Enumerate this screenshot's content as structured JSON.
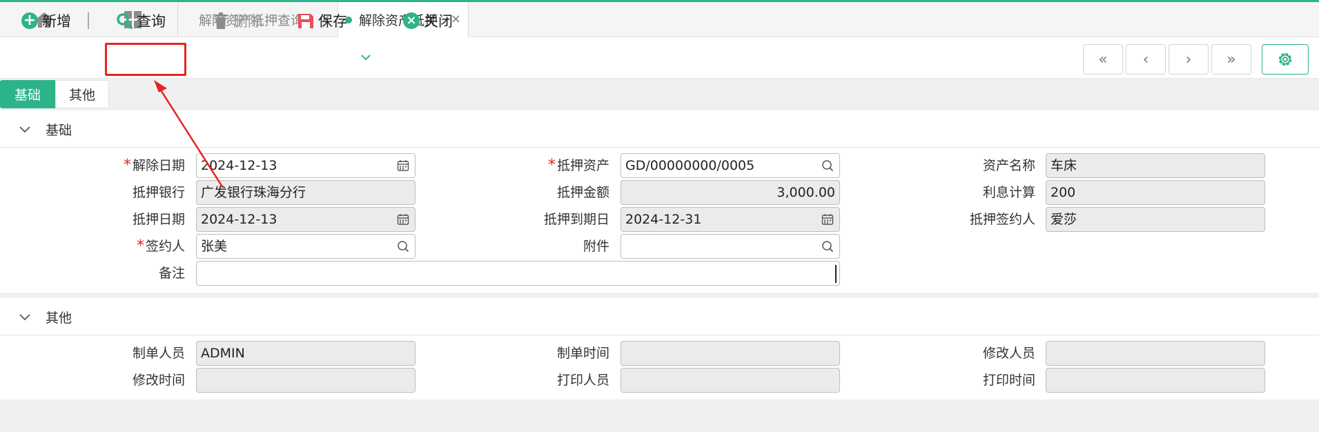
{
  "tabs": [
    {
      "label": "解除资产抵押查询",
      "close": "×"
    },
    {
      "label": "解除资产抵押",
      "close": "×"
    }
  ],
  "toolbar": {
    "add": "新增",
    "query": "查询",
    "delete": "删除",
    "save": "保存",
    "close": "关闭"
  },
  "nav": {
    "first": "«",
    "prev": "‹",
    "next": "›",
    "last": "»"
  },
  "subtabs": [
    "基础",
    "其他"
  ],
  "basic": {
    "title": "基础",
    "fields": {
      "release_date": {
        "label": "解除日期",
        "value": "2024-12-13"
      },
      "pledged_asset": {
        "label": "抵押资产",
        "value": "GD/00000000/0005"
      },
      "asset_name": {
        "label": "资产名称",
        "value": "车床"
      },
      "pledge_bank": {
        "label": "抵押银行",
        "value": "广发银行珠海分行"
      },
      "pledge_amount": {
        "label": "抵押金额",
        "value": "3,000.00"
      },
      "interest_calc": {
        "label": "利息计算",
        "value": "200"
      },
      "pledge_date": {
        "label": "抵押日期",
        "value": "2024-12-13"
      },
      "pledge_due_date": {
        "label": "抵押到期日",
        "value": "2024-12-31"
      },
      "pledge_signer": {
        "label": "抵押签约人",
        "value": "爱莎"
      },
      "signer": {
        "label": "签约人",
        "value": "张美"
      },
      "attachment": {
        "label": "附件",
        "value": ""
      },
      "remark": {
        "label": "备注",
        "value": ""
      }
    }
  },
  "other": {
    "title": "其他",
    "fields": {
      "creator": {
        "label": "制单人员",
        "value": "ADMIN"
      },
      "create_time": {
        "label": "制单时间",
        "value": ""
      },
      "modifier": {
        "label": "修改人员",
        "value": ""
      },
      "modify_time": {
        "label": "修改时间",
        "value": ""
      },
      "printer": {
        "label": "打印人员",
        "value": ""
      },
      "print_time": {
        "label": "打印时间",
        "value": ""
      }
    }
  },
  "colors": {
    "accent": "#2db38a",
    "annotation": "#e8231e",
    "add_icon": "#2db38a",
    "save_icon": "#e8505b",
    "close_icon": "#2db38a"
  },
  "icons": [
    "home-icon",
    "grid-icon",
    "plus-circle-icon",
    "search-icon",
    "trash-icon",
    "save-icon",
    "chevron-down-icon",
    "close-circle-icon",
    "gear-icon",
    "calendar-icon",
    "magnifier-icon"
  ]
}
